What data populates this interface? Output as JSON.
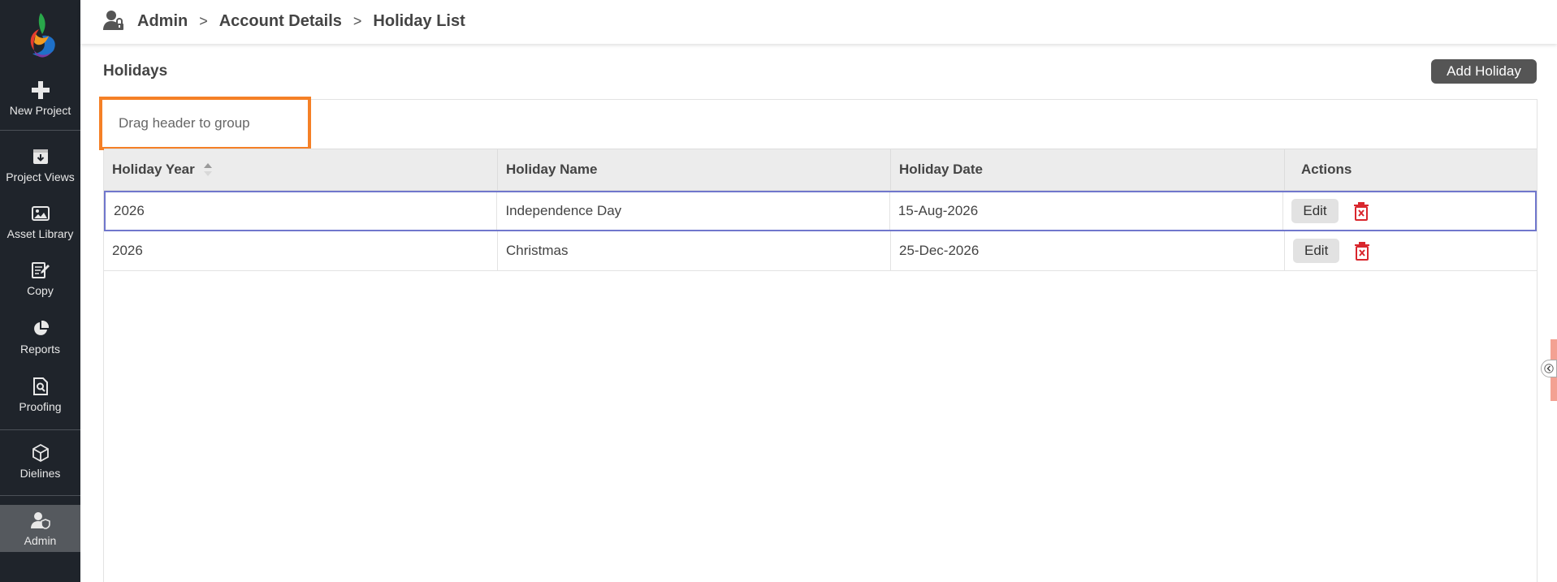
{
  "sidebar": {
    "items": [
      {
        "label": "New Project",
        "icon": "plus-icon"
      },
      {
        "label": "Project Views",
        "icon": "inbox-download-icon"
      },
      {
        "label": "Asset Library",
        "icon": "image-icon"
      },
      {
        "label": "Copy",
        "icon": "edit-document-icon"
      },
      {
        "label": "Reports",
        "icon": "pie-chart-icon"
      },
      {
        "label": "Proofing",
        "icon": "search-document-icon"
      },
      {
        "label": "Dielines",
        "icon": "box-icon"
      },
      {
        "label": "Admin",
        "icon": "user-shield-icon"
      }
    ]
  },
  "breadcrumb": {
    "items": [
      "Admin",
      "Account Details",
      "Holiday List"
    ],
    "separator": ">"
  },
  "page": {
    "title": "Holidays",
    "add_button": "Add Holiday",
    "group_hint": "Drag header to group"
  },
  "table": {
    "headers": [
      "Holiday Year",
      "Holiday Name",
      "Holiday Date",
      "Actions"
    ],
    "rows": [
      {
        "year": "2026",
        "name": "Independence Day",
        "date": "15-Aug-2026",
        "edit": "Edit"
      },
      {
        "year": "2026",
        "name": "Christmas",
        "date": "25-Dec-2026",
        "edit": "Edit"
      }
    ]
  },
  "colors": {
    "sidebar_bg": "#1f242b",
    "accent_orange": "#f58026",
    "delete_red": "#d9262d",
    "selected_border": "#7077cc"
  }
}
